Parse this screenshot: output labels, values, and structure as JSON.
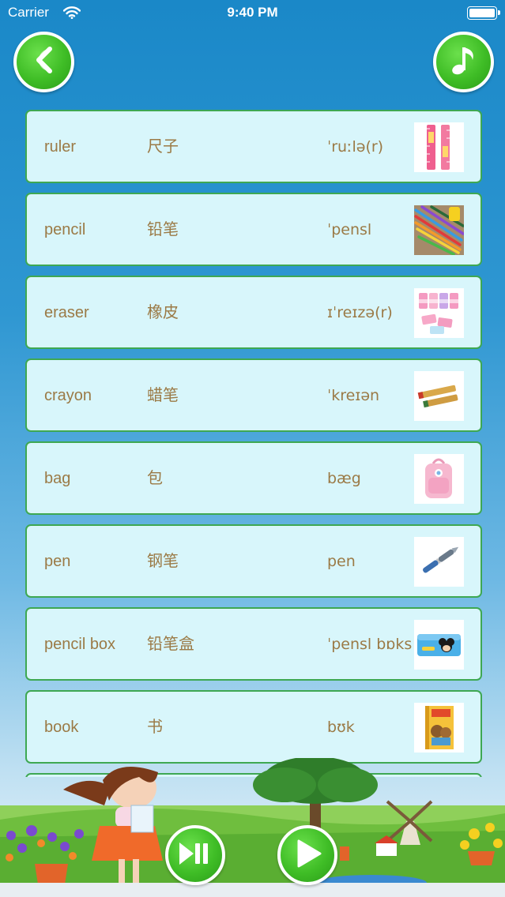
{
  "status_bar": {
    "carrier": "Carrier",
    "time": "9:40 PM"
  },
  "header": {
    "back_icon": "chevron-left-icon",
    "music_icon": "music-note-icon"
  },
  "colors": {
    "button_green": "#3fbd26",
    "row_background": "#d8f6fb",
    "row_border": "#3ea852",
    "text_brown": "#9b7a46",
    "sky_blue": "#1a88c8"
  },
  "words": [
    {
      "english": "ruler",
      "chinese": "尺子",
      "phonetic": "ˈruːlə(r)",
      "image": "ruler-image"
    },
    {
      "english": "pencil",
      "chinese": "铅笔",
      "phonetic": "ˈpensl",
      "image": "colored-pencils-image"
    },
    {
      "english": "eraser",
      "chinese": "橡皮",
      "phonetic": "ɪˈreɪzə(r)",
      "image": "erasers-image"
    },
    {
      "english": "crayon",
      "chinese": "蜡笔",
      "phonetic": "ˈkreɪən",
      "image": "crayons-image"
    },
    {
      "english": "bag",
      "chinese": "包",
      "phonetic": "bæg",
      "image": "pink-backpack-image"
    },
    {
      "english": "pen",
      "chinese": "钢笔",
      "phonetic": "pen",
      "image": "fountain-pen-image"
    },
    {
      "english": "pencil box",
      "chinese": "铅笔盒",
      "phonetic": "ˈpensl bɒks",
      "image": "pencil-box-image"
    },
    {
      "english": "book",
      "chinese": "书",
      "phonetic": "bʊk",
      "image": "book-image"
    }
  ],
  "controls": {
    "play_pause_icon": "play-pause-icon",
    "play_icon": "play-icon"
  }
}
